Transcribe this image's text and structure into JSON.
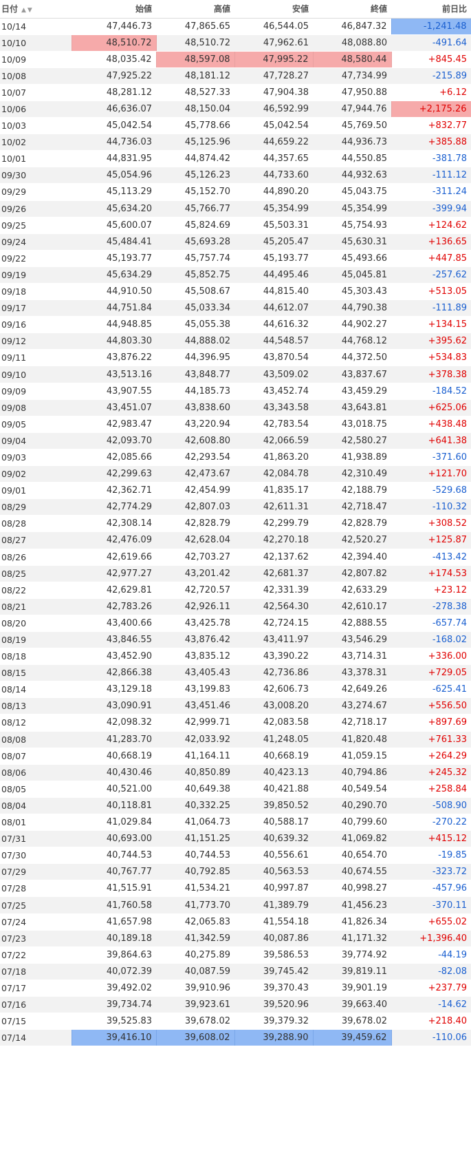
{
  "table": {
    "headers": {
      "date": "日付",
      "open": "始値",
      "high": "高値",
      "low": "安値",
      "close": "終値",
      "change": "前日比"
    },
    "sort_icons": "▲▼",
    "rows": [
      {
        "date": "10/14",
        "open": "47,446.73",
        "high": "47,865.65",
        "low": "46,544.05",
        "close": "46,847.32",
        "change": "-1,241.48",
        "hl": {
          "change": "min"
        }
      },
      {
        "date": "10/10",
        "open": "48,510.72",
        "high": "48,510.72",
        "low": "47,962.61",
        "close": "48,088.80",
        "change": "-491.64",
        "hl": {
          "open": "max"
        }
      },
      {
        "date": "10/09",
        "open": "48,035.42",
        "high": "48,597.08",
        "low": "47,995.22",
        "close": "48,580.44",
        "change": "+845.45",
        "hl": {
          "high": "max",
          "low": "max",
          "close": "max"
        }
      },
      {
        "date": "10/08",
        "open": "47,925.22",
        "high": "48,181.12",
        "low": "47,728.27",
        "close": "47,734.99",
        "change": "-215.89"
      },
      {
        "date": "10/07",
        "open": "48,281.12",
        "high": "48,527.33",
        "low": "47,904.38",
        "close": "47,950.88",
        "change": "+6.12"
      },
      {
        "date": "10/06",
        "open": "46,636.07",
        "high": "48,150.04",
        "low": "46,592.99",
        "close": "47,944.76",
        "change": "+2,175.26",
        "hl": {
          "change": "max"
        }
      },
      {
        "date": "10/03",
        "open": "45,042.54",
        "high": "45,778.66",
        "low": "45,042.54",
        "close": "45,769.50",
        "change": "+832.77"
      },
      {
        "date": "10/02",
        "open": "44,736.03",
        "high": "45,125.96",
        "low": "44,659.22",
        "close": "44,936.73",
        "change": "+385.88"
      },
      {
        "date": "10/01",
        "open": "44,831.95",
        "high": "44,874.42",
        "low": "44,357.65",
        "close": "44,550.85",
        "change": "-381.78"
      },
      {
        "date": "09/30",
        "open": "45,054.96",
        "high": "45,126.23",
        "low": "44,733.60",
        "close": "44,932.63",
        "change": "-111.12"
      },
      {
        "date": "09/29",
        "open": "45,113.29",
        "high": "45,152.70",
        "low": "44,890.20",
        "close": "45,043.75",
        "change": "-311.24"
      },
      {
        "date": "09/26",
        "open": "45,634.20",
        "high": "45,766.77",
        "low": "45,354.99",
        "close": "45,354.99",
        "change": "-399.94"
      },
      {
        "date": "09/25",
        "open": "45,600.07",
        "high": "45,824.69",
        "low": "45,503.31",
        "close": "45,754.93",
        "change": "+124.62"
      },
      {
        "date": "09/24",
        "open": "45,484.41",
        "high": "45,693.28",
        "low": "45,205.47",
        "close": "45,630.31",
        "change": "+136.65"
      },
      {
        "date": "09/22",
        "open": "45,193.77",
        "high": "45,757.74",
        "low": "45,193.77",
        "close": "45,493.66",
        "change": "+447.85"
      },
      {
        "date": "09/19",
        "open": "45,634.29",
        "high": "45,852.75",
        "low": "44,495.46",
        "close": "45,045.81",
        "change": "-257.62"
      },
      {
        "date": "09/18",
        "open": "44,910.50",
        "high": "45,508.67",
        "low": "44,815.40",
        "close": "45,303.43",
        "change": "+513.05"
      },
      {
        "date": "09/17",
        "open": "44,751.84",
        "high": "45,033.34",
        "low": "44,612.07",
        "close": "44,790.38",
        "change": "-111.89"
      },
      {
        "date": "09/16",
        "open": "44,948.85",
        "high": "45,055.38",
        "low": "44,616.32",
        "close": "44,902.27",
        "change": "+134.15"
      },
      {
        "date": "09/12",
        "open": "44,803.30",
        "high": "44,888.02",
        "low": "44,548.57",
        "close": "44,768.12",
        "change": "+395.62"
      },
      {
        "date": "09/11",
        "open": "43,876.22",
        "high": "44,396.95",
        "low": "43,870.54",
        "close": "44,372.50",
        "change": "+534.83"
      },
      {
        "date": "09/10",
        "open": "43,513.16",
        "high": "43,848.77",
        "low": "43,509.02",
        "close": "43,837.67",
        "change": "+378.38"
      },
      {
        "date": "09/09",
        "open": "43,907.55",
        "high": "44,185.73",
        "low": "43,452.74",
        "close": "43,459.29",
        "change": "-184.52"
      },
      {
        "date": "09/08",
        "open": "43,451.07",
        "high": "43,838.60",
        "low": "43,343.58",
        "close": "43,643.81",
        "change": "+625.06"
      },
      {
        "date": "09/05",
        "open": "42,983.47",
        "high": "43,220.94",
        "low": "42,783.54",
        "close": "43,018.75",
        "change": "+438.48"
      },
      {
        "date": "09/04",
        "open": "42,093.70",
        "high": "42,608.80",
        "low": "42,066.59",
        "close": "42,580.27",
        "change": "+641.38"
      },
      {
        "date": "09/03",
        "open": "42,085.66",
        "high": "42,293.54",
        "low": "41,863.20",
        "close": "41,938.89",
        "change": "-371.60"
      },
      {
        "date": "09/02",
        "open": "42,299.63",
        "high": "42,473.67",
        "low": "42,084.78",
        "close": "42,310.49",
        "change": "+121.70"
      },
      {
        "date": "09/01",
        "open": "42,362.71",
        "high": "42,454.99",
        "low": "41,835.17",
        "close": "42,188.79",
        "change": "-529.68"
      },
      {
        "date": "08/29",
        "open": "42,774.29",
        "high": "42,807.03",
        "low": "42,611.31",
        "close": "42,718.47",
        "change": "-110.32"
      },
      {
        "date": "08/28",
        "open": "42,308.14",
        "high": "42,828.79",
        "low": "42,299.79",
        "close": "42,828.79",
        "change": "+308.52"
      },
      {
        "date": "08/27",
        "open": "42,476.09",
        "high": "42,628.04",
        "low": "42,270.18",
        "close": "42,520.27",
        "change": "+125.87"
      },
      {
        "date": "08/26",
        "open": "42,619.66",
        "high": "42,703.27",
        "low": "42,137.62",
        "close": "42,394.40",
        "change": "-413.42"
      },
      {
        "date": "08/25",
        "open": "42,977.27",
        "high": "43,201.42",
        "low": "42,681.37",
        "close": "42,807.82",
        "change": "+174.53"
      },
      {
        "date": "08/22",
        "open": "42,629.81",
        "high": "42,720.57",
        "low": "42,331.39",
        "close": "42,633.29",
        "change": "+23.12"
      },
      {
        "date": "08/21",
        "open": "42,783.26",
        "high": "42,926.11",
        "low": "42,564.30",
        "close": "42,610.17",
        "change": "-278.38"
      },
      {
        "date": "08/20",
        "open": "43,400.66",
        "high": "43,425.78",
        "low": "42,724.15",
        "close": "42,888.55",
        "change": "-657.74"
      },
      {
        "date": "08/19",
        "open": "43,846.55",
        "high": "43,876.42",
        "low": "43,411.97",
        "close": "43,546.29",
        "change": "-168.02"
      },
      {
        "date": "08/18",
        "open": "43,452.90",
        "high": "43,835.12",
        "low": "43,390.22",
        "close": "43,714.31",
        "change": "+336.00"
      },
      {
        "date": "08/15",
        "open": "42,866.38",
        "high": "43,405.43",
        "low": "42,736.86",
        "close": "43,378.31",
        "change": "+729.05"
      },
      {
        "date": "08/14",
        "open": "43,129.18",
        "high": "43,199.83",
        "low": "42,606.73",
        "close": "42,649.26",
        "change": "-625.41"
      },
      {
        "date": "08/13",
        "open": "43,090.91",
        "high": "43,451.46",
        "low": "43,008.20",
        "close": "43,274.67",
        "change": "+556.50"
      },
      {
        "date": "08/12",
        "open": "42,098.32",
        "high": "42,999.71",
        "low": "42,083.58",
        "close": "42,718.17",
        "change": "+897.69"
      },
      {
        "date": "08/08",
        "open": "41,283.70",
        "high": "42,033.92",
        "low": "41,248.05",
        "close": "41,820.48",
        "change": "+761.33"
      },
      {
        "date": "08/07",
        "open": "40,668.19",
        "high": "41,164.11",
        "low": "40,668.19",
        "close": "41,059.15",
        "change": "+264.29"
      },
      {
        "date": "08/06",
        "open": "40,430.46",
        "high": "40,850.89",
        "low": "40,423.13",
        "close": "40,794.86",
        "change": "+245.32"
      },
      {
        "date": "08/05",
        "open": "40,521.00",
        "high": "40,649.38",
        "low": "40,421.88",
        "close": "40,549.54",
        "change": "+258.84"
      },
      {
        "date": "08/04",
        "open": "40,118.81",
        "high": "40,332.25",
        "low": "39,850.52",
        "close": "40,290.70",
        "change": "-508.90"
      },
      {
        "date": "08/01",
        "open": "41,029.84",
        "high": "41,064.73",
        "low": "40,588.17",
        "close": "40,799.60",
        "change": "-270.22"
      },
      {
        "date": "07/31",
        "open": "40,693.00",
        "high": "41,151.25",
        "low": "40,639.32",
        "close": "41,069.82",
        "change": "+415.12"
      },
      {
        "date": "07/30",
        "open": "40,744.53",
        "high": "40,744.53",
        "low": "40,556.61",
        "close": "40,654.70",
        "change": "-19.85"
      },
      {
        "date": "07/29",
        "open": "40,767.77",
        "high": "40,792.85",
        "low": "40,563.53",
        "close": "40,674.55",
        "change": "-323.72"
      },
      {
        "date": "07/28",
        "open": "41,515.91",
        "high": "41,534.21",
        "low": "40,997.87",
        "close": "40,998.27",
        "change": "-457.96"
      },
      {
        "date": "07/25",
        "open": "41,760.58",
        "high": "41,773.70",
        "low": "41,389.79",
        "close": "41,456.23",
        "change": "-370.11"
      },
      {
        "date": "07/24",
        "open": "41,657.98",
        "high": "42,065.83",
        "low": "41,554.18",
        "close": "41,826.34",
        "change": "+655.02"
      },
      {
        "date": "07/23",
        "open": "40,189.18",
        "high": "41,342.59",
        "low": "40,087.86",
        "close": "41,171.32",
        "change": "+1,396.40"
      },
      {
        "date": "07/22",
        "open": "39,864.63",
        "high": "40,275.89",
        "low": "39,586.53",
        "close": "39,774.92",
        "change": "-44.19"
      },
      {
        "date": "07/18",
        "open": "40,072.39",
        "high": "40,087.59",
        "low": "39,745.42",
        "close": "39,819.11",
        "change": "-82.08"
      },
      {
        "date": "07/17",
        "open": "39,492.02",
        "high": "39,910.96",
        "low": "39,370.43",
        "close": "39,901.19",
        "change": "+237.79"
      },
      {
        "date": "07/16",
        "open": "39,734.74",
        "high": "39,923.61",
        "low": "39,520.96",
        "close": "39,663.40",
        "change": "-14.62"
      },
      {
        "date": "07/15",
        "open": "39,525.83",
        "high": "39,678.02",
        "low": "39,379.32",
        "close": "39,678.02",
        "change": "+218.40"
      },
      {
        "date": "07/14",
        "open": "39,416.10",
        "high": "39,608.02",
        "low": "39,288.90",
        "close": "39,459.62",
        "change": "-110.06",
        "hl": {
          "open": "min",
          "high": "min",
          "low": "min",
          "close": "min"
        }
      }
    ]
  },
  "colors": {
    "positive": "#e00000",
    "negative": "#1a5fd0",
    "highlight_max": "#f6aaaa",
    "highlight_min": "#8fb8f4"
  }
}
